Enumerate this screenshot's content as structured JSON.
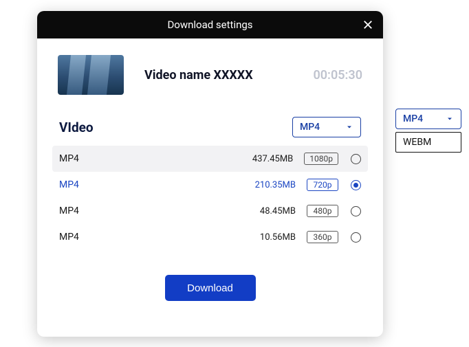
{
  "dialog": {
    "title": "Download settings",
    "video_name": "Video name XXXXX",
    "duration": "00:05:30",
    "section_label": "VIdeo",
    "format_selected": "MP4",
    "download_label": "Download"
  },
  "options": [
    {
      "format": "MP4",
      "size": "437.45MB",
      "resolution": "1080p"
    },
    {
      "format": "MP4",
      "size": "210.35MB",
      "resolution": "720p"
    },
    {
      "format": "MP4",
      "size": "48.45MB",
      "resolution": "480p"
    },
    {
      "format": "MP4",
      "size": "10.56MB",
      "resolution": "360p"
    }
  ],
  "selected_index": 1,
  "dropdown": {
    "selected": "MP4",
    "items": [
      "WEBM"
    ]
  }
}
